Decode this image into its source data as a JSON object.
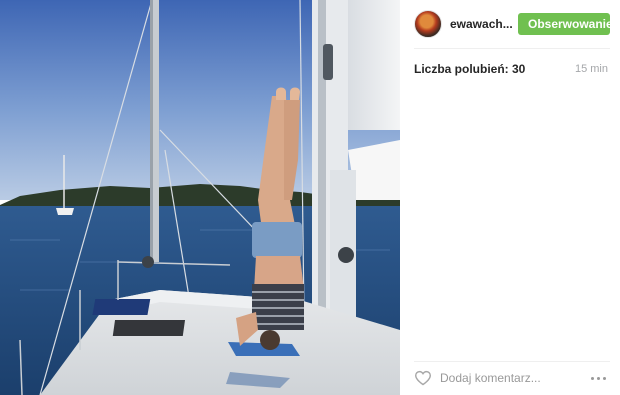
{
  "post": {
    "username": "ewawach...",
    "follow_label": "Obserwowanie",
    "likes_text": "Liczba polubień: 30",
    "timestamp": "15 min"
  },
  "comment": {
    "placeholder": "Dodaj komentarz..."
  },
  "icons": {
    "like": "heart-outline-icon",
    "more": "ellipsis-icon"
  },
  "colors": {
    "follow_button": "#70c050",
    "secondary_text": "#a5a7aa",
    "primary_text": "#262626"
  }
}
